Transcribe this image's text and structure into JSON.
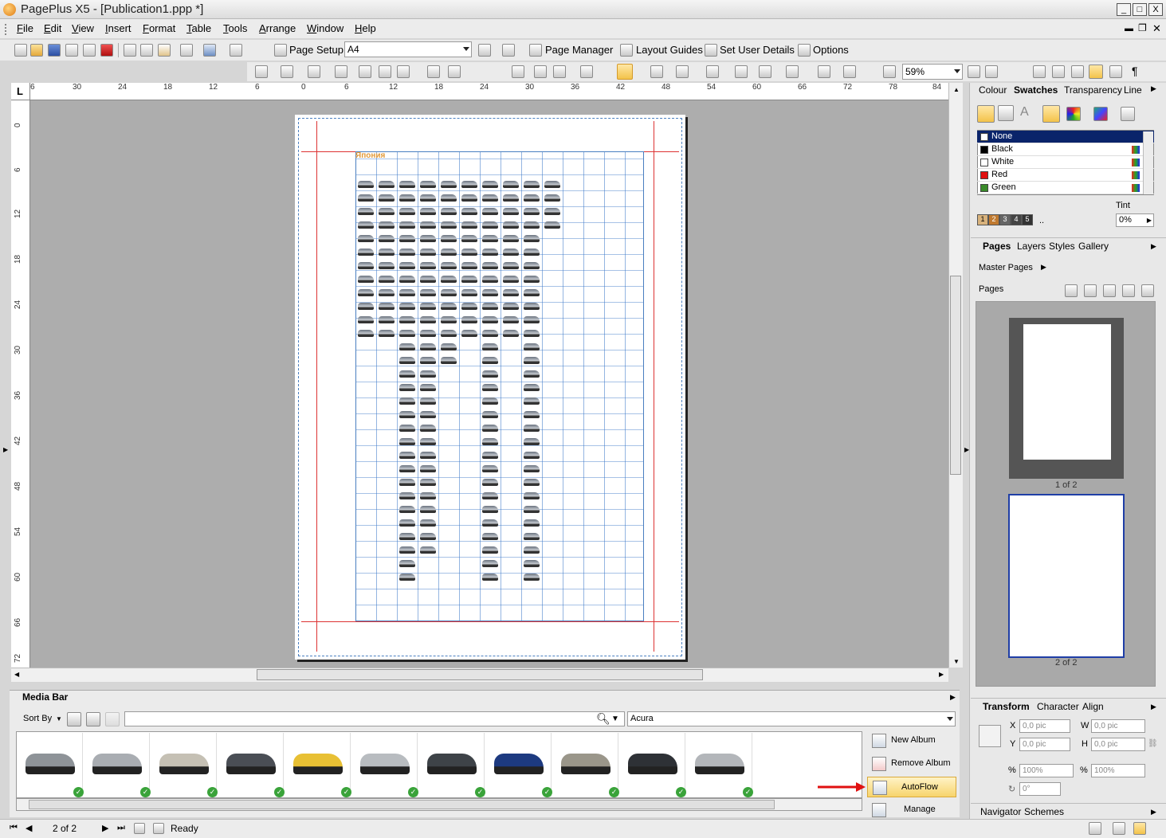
{
  "window": {
    "title": "PagePlus X5 - [Publication1.ppp *]",
    "min_label": "_",
    "max_label": "□",
    "close_label": "X"
  },
  "menu": {
    "items": [
      "File",
      "Edit",
      "View",
      "Insert",
      "Format",
      "Table",
      "Tools",
      "Arrange",
      "Window",
      "Help"
    ]
  },
  "toolbar1": {
    "page_setup_label": "Page Setup",
    "page_size_value": "A4",
    "page_manager_label": "Page Manager",
    "layout_guides_label": "Layout Guides",
    "set_user_details_label": "Set User Details",
    "options_label": "Options"
  },
  "toolbar2": {
    "zoom_value": "59%"
  },
  "ruler": {
    "h_ticks": [
      "6",
      "30",
      "24",
      "18",
      "12",
      "6",
      "0",
      "6",
      "12",
      "18",
      "24",
      "30",
      "36",
      "42",
      "48",
      "54",
      "60",
      "66",
      "72",
      "78",
      "84"
    ],
    "v_ticks": [
      "0",
      "6",
      "12",
      "18",
      "24",
      "30",
      "36",
      "42",
      "48",
      "54",
      "60",
      "66",
      "72"
    ],
    "corner_label": "L"
  },
  "page": {
    "heading": "Япония"
  },
  "colour_panel": {
    "tabs": [
      "Colour",
      "Swatches",
      "Transparency",
      "Line"
    ],
    "active_tab": "Swatches",
    "swatches": [
      {
        "name": "None",
        "color": "#ffffff"
      },
      {
        "name": "Black",
        "color": "#000000"
      },
      {
        "name": "White",
        "color": "#ffffff"
      },
      {
        "name": "Red",
        "color": "#e01010"
      },
      {
        "name": "Green",
        "color": "#3a8a2a"
      }
    ],
    "tint_label": "Tint",
    "tint_value": "0%",
    "tint_swatches": [
      "1",
      "2",
      "3",
      "4",
      "5"
    ],
    "tint_more": ".."
  },
  "pages_panel": {
    "tabs": [
      "Pages",
      "Layers",
      "Styles",
      "Gallery"
    ],
    "active_tab": "Pages",
    "master_pages_label": "Master Pages",
    "pages_label": "Pages",
    "thumbs": [
      {
        "caption": "1 of 2"
      },
      {
        "caption": "2 of 2"
      }
    ]
  },
  "transform_panel": {
    "tabs": [
      "Transform",
      "Character",
      "Align"
    ],
    "active_tab": "Transform",
    "x_label": "X",
    "x_value": "0,0 pic",
    "y_label": "Y",
    "y_value": "0,0 pic",
    "w_label": "W",
    "w_value": "0,0 pic",
    "h_label": "H",
    "h_value": "0,0 pic",
    "scale_x_value": "100%",
    "scale_y_value": "100%",
    "rotate_value": "0°"
  },
  "navigator_panel": {
    "tabs": [
      "Navigator",
      "Schemes"
    ]
  },
  "media_bar": {
    "title": "Media Bar",
    "sort_by_label": "Sort By",
    "search_value": "",
    "album_value": "Acura",
    "thumbnails": [
      {
        "color": "#8e9398"
      },
      {
        "color": "#a9adb2"
      },
      {
        "color": "#c5c0b4"
      },
      {
        "color": "#4a4e55"
      },
      {
        "color": "#e8c034"
      },
      {
        "color": "#b8bcc0"
      },
      {
        "color": "#3e4348"
      },
      {
        "color": "#1d3a80"
      },
      {
        "color": "#9a968a"
      },
      {
        "color": "#2e3136"
      },
      {
        "color": "#b3b6ba"
      }
    ],
    "check_glyph": "✓",
    "buttons": {
      "new_album": "New Album",
      "remove_album": "Remove Album",
      "autoflow": "AutoFlow",
      "manage": "Manage"
    }
  },
  "status": {
    "page_indicator": "2 of 2",
    "status_text": "Ready"
  }
}
